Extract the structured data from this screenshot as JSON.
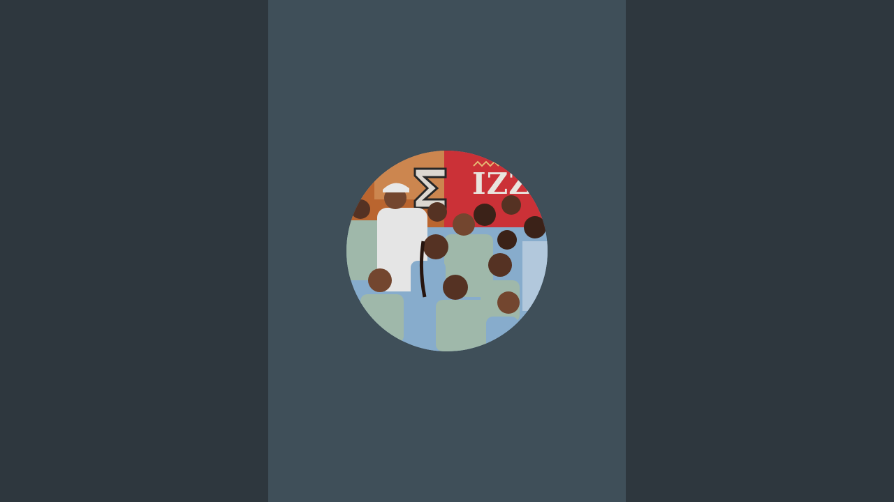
{
  "page": {
    "background_color": "#2e373e",
    "stage_color": "#3f4f59"
  },
  "avatar": {
    "description_icon": "group-photo",
    "sign_text": "IZZ",
    "colors": {
      "backdrop_red": "#d6343a",
      "backdrop_orange": "#c46b32",
      "shirt_sage": "#a8c2b4",
      "shirt_blue": "#8fb6d7",
      "shirt_white": "#f2f2f2",
      "skin_dark": "#5a3525",
      "skin_medium": "#7a4a32"
    }
  }
}
